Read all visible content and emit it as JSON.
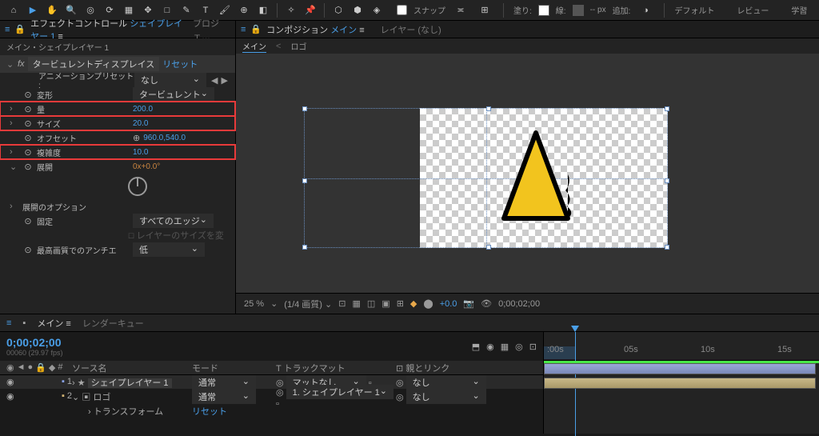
{
  "toolbar": {
    "snap_label": "スナップ",
    "fill_label": "塗り:",
    "fill_color": "#ffffff",
    "stroke_label": "線:",
    "stroke_color": "#555555",
    "stroke_px": "-- px",
    "add_label": "追加:",
    "default_label": "デフォルト",
    "review_label": "レビュー",
    "learn_label": "学習"
  },
  "effect_panel": {
    "tab_label": "エフェクトコントロール",
    "tab_layer": "シェイプレイヤー 1",
    "other_tab": "プロジェ…",
    "subtitle": "メイン・シェイプレイヤー 1",
    "fx_name": "タービュレントディスプレイス",
    "reset": "リセット",
    "anim_preset_label": "アニメーションプリセット :",
    "anim_preset_value": "なし",
    "props": {
      "displacement_label": "変形",
      "displacement_value": "タービュレント",
      "amount_label": "量",
      "amount_value": "200.0",
      "size_label": "サイズ",
      "size_value": "20.0",
      "offset_label": "オフセット",
      "offset_value": "960.0,540.0",
      "complexity_label": "複雑度",
      "complexity_value": "10.0",
      "evolution_label": "展開",
      "evolution_value": "0x+0.0°",
      "evolution_options": "展開のオプション",
      "pinning_label": "固定",
      "pinning_value": "すべてのエッジ",
      "resize_label": "レイヤーのサイズを変",
      "antialias_label": "最高画質でのアンチエ",
      "antialias_value": "低"
    }
  },
  "viewer": {
    "tab_label": "コンポジション",
    "tab_comp": "メイン",
    "other_tab": "レイヤー (なし)",
    "subtab_main": "メイン",
    "subtab_logo": "ロゴ",
    "footer_zoom": "25 %",
    "footer_res": "(1/4 画質)",
    "footer_exposure": "+0.0",
    "footer_time": "0;00;02;00"
  },
  "timeline": {
    "tab_main": "メイン",
    "tab_render": "レンダーキュー",
    "timecode": "0;00;02;00",
    "timecode_sub": "00060 (29.97 fps)",
    "search_placeholder": "",
    "col_source": "ソース名",
    "col_mode": "モード",
    "col_trackmatte": "T トラックマット",
    "col_parent": "親とリンク",
    "layers": [
      {
        "num": "1",
        "name": "シェイプレイヤー 1",
        "mode": "通常",
        "matte": "マットなし",
        "parent": "なし"
      },
      {
        "num": "2",
        "name": "ロゴ",
        "mode": "通常",
        "matte": "1. シェイプレイヤー 1",
        "parent": "なし"
      }
    ],
    "transform_label": "トランスフォーム",
    "transform_reset": "リセット",
    "ruler_marks": [
      ":00s",
      "05s",
      "10s",
      "15s"
    ]
  }
}
